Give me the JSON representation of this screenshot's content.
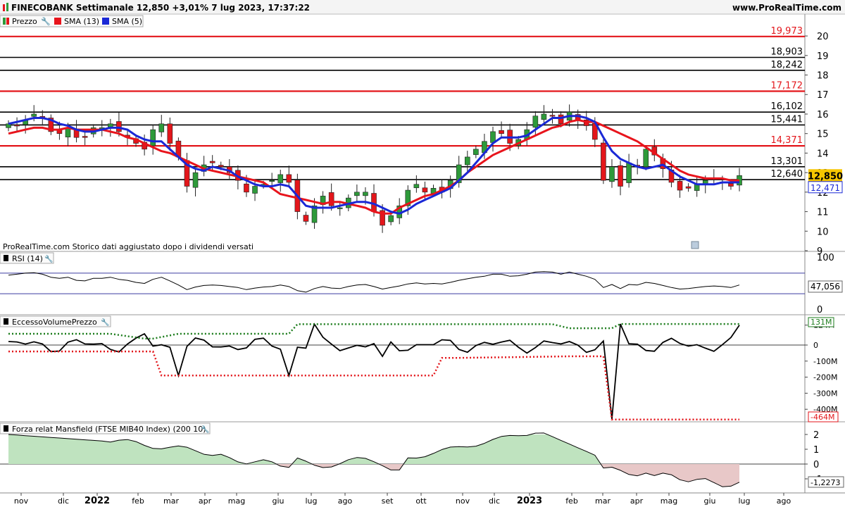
{
  "header": {
    "title": "FINECOBANK Settimanale 12,850 +3,01% 7 lug 2023, 17:37:22",
    "site": "www.ProRealTime.com"
  },
  "legend": {
    "price": "Prezzo",
    "sma13": "SMA (13)",
    "sma5": "SMA (5)"
  },
  "footnote": "ProRealTime.com  Storico dati aggiustato dopo i dividendi versati",
  "panels": {
    "rsi_title": "RSI (14)",
    "evp_title": "EccessoVolumePrezzo",
    "mansfield_title": "Forza relat Mansfield (FTSE MIB40 Index) (200 10)"
  },
  "colors": {
    "up": "#2e9a3a",
    "down": "#e3161b",
    "sma13": "#e8141c",
    "sma5": "#1a28d6",
    "level_red": "#e3161b",
    "level_black": "#000000",
    "rsi_band": "#3c3ca0",
    "dotted_green": "#1d7d1d",
    "dotted_red": "#e3161b",
    "mansfield_pos": "#bfe3bf",
    "mansfield_neg": "#e8c8c8",
    "last_price_bg": "#f7c600"
  },
  "chart_data": [
    {
      "type": "candlestick",
      "title": "FINECOBANK Settimanale",
      "last_price": "12,850",
      "change": "+3,01%",
      "sma13_label": "SMA (13)",
      "sma5_label": "SMA (5)",
      "sma5_last": "12,471",
      "ylim": [
        9,
        20.5
      ],
      "yticks": [
        "9",
        "10",
        "11",
        "12",
        "13",
        "14",
        "15",
        "16",
        "17",
        "18",
        "19",
        "20"
      ],
      "xticks": [
        "nov",
        "dic",
        "2022",
        "feb",
        "mar",
        "apr",
        "mag",
        "giu",
        "lug",
        "ago",
        "set",
        "ott",
        "nov",
        "dic",
        "2023",
        "feb",
        "mar",
        "apr",
        "mag",
        "giu",
        "lug",
        "ago"
      ],
      "levels": [
        {
          "value": 19.973,
          "label": "19,973",
          "color": "red"
        },
        {
          "value": 18.903,
          "label": "18,903",
          "color": "black"
        },
        {
          "value": 18.242,
          "label": "18,242",
          "color": "black"
        },
        {
          "value": 17.172,
          "label": "17,172",
          "color": "red"
        },
        {
          "value": 16.102,
          "label": "16,102",
          "color": "black"
        },
        {
          "value": 15.441,
          "label": "15,441",
          "color": "black"
        },
        {
          "value": 14.371,
          "label": "14,371",
          "color": "red"
        },
        {
          "value": 13.301,
          "label": "13,301",
          "color": "black"
        },
        {
          "value": 12.64,
          "label": "12,640",
          "color": "black"
        }
      ],
      "closes": [
        15.5,
        15.4,
        15.7,
        16.0,
        15.8,
        15.1,
        15.0,
        15.3,
        14.8,
        14.8,
        15.3,
        15.3,
        15.5,
        15.1,
        14.8,
        14.5,
        14.2,
        15.2,
        15.5,
        14.5,
        13.8,
        12.3,
        13.0,
        13.4,
        13.5,
        13.3,
        13.0,
        12.6,
        12.0,
        12.3,
        12.4,
        12.6,
        12.9,
        12.5,
        11.0,
        10.5,
        11.3,
        11.8,
        11.3,
        11.2,
        11.7,
        12.0,
        12.0,
        11.0,
        10.3,
        10.8,
        11.3,
        12.1,
        12.4,
        12.0,
        12.2,
        12.0,
        12.6,
        13.4,
        13.8,
        14.2,
        14.6,
        15.1,
        15.0,
        14.5,
        14.7,
        15.2,
        15.9,
        16.0,
        15.9,
        15.5,
        16.1,
        15.7,
        15.4,
        14.7,
        12.6,
        13.3,
        12.3,
        13.5,
        13.3,
        14.2,
        13.9,
        13.2,
        12.5,
        12.1,
        12.2,
        12.4,
        12.6,
        12.7,
        12.5,
        12.3,
        12.85
      ],
      "sma13": [
        15.0,
        15.1,
        15.2,
        15.3,
        15.3,
        15.2,
        15.2,
        15.3,
        15.2,
        15.2,
        15.2,
        15.2,
        15.1,
        15.0,
        14.8,
        14.7,
        14.5,
        14.3,
        14.1,
        14.0,
        13.8,
        13.6,
        13.4,
        13.2,
        13.1,
        13.0,
        12.9,
        12.8,
        12.7,
        12.6,
        12.5,
        12.2,
        11.9,
        11.8,
        11.7,
        11.6,
        11.5,
        11.4,
        11.5,
        11.5,
        11.4,
        11.3,
        11.2,
        11.0,
        10.9,
        10.9,
        11.2,
        11.4,
        11.6,
        11.8,
        11.9,
        12.1,
        12.3,
        12.6,
        13.0,
        13.3,
        13.6,
        13.9,
        14.1,
        14.3,
        14.5,
        14.7,
        14.9,
        15.1,
        15.3,
        15.4,
        15.6,
        15.7,
        15.6,
        15.6,
        15.4,
        15.2,
        15.0,
        14.8,
        14.6,
        14.3,
        14.0,
        13.7,
        13.4,
        13.1,
        12.9,
        12.8,
        12.7,
        12.7,
        12.7,
        12.6,
        12.6
      ],
      "sma5": [
        15.5,
        15.6,
        15.7,
        15.8,
        15.8,
        15.7,
        15.5,
        15.4,
        15.2,
        15.1,
        15.1,
        15.2,
        15.3,
        15.3,
        15.2,
        14.9,
        14.7,
        14.6,
        14.6,
        14.2,
        13.8,
        13.4,
        13.2,
        13.1,
        13.3,
        13.2,
        13.1,
        12.8,
        12.6,
        12.4,
        12.3,
        12.3,
        12.4,
        12.3,
        11.8,
        11.3,
        11.2,
        11.2,
        11.2,
        11.3,
        11.4,
        11.5,
        11.5,
        11.4,
        11.2,
        11.0,
        10.9,
        11.1,
        11.4,
        11.6,
        11.8,
        12.0,
        12.2,
        12.6,
        13.0,
        13.5,
        14.0,
        14.5,
        14.8,
        14.8,
        14.8,
        14.9,
        15.2,
        15.5,
        15.8,
        15.8,
        15.9,
        15.9,
        15.8,
        15.6,
        14.8,
        14.1,
        13.7,
        13.5,
        13.3,
        13.2,
        13.3,
        13.4,
        13.1,
        12.8,
        12.6,
        12.4,
        12.4,
        12.4,
        12.5,
        12.5,
        12.5
      ]
    },
    {
      "type": "line",
      "title": "RSI (14)",
      "ylim": [
        0,
        100
      ],
      "yticks": [
        "0",
        "100"
      ],
      "bands": [
        30,
        70
      ],
      "last_value": "47,056",
      "values": [
        66,
        68,
        70,
        71,
        68,
        62,
        60,
        62,
        56,
        55,
        60,
        60,
        62,
        58,
        56,
        52,
        50,
        58,
        62,
        55,
        47,
        38,
        43,
        46,
        47,
        46,
        44,
        42,
        38,
        41,
        43,
        44,
        47,
        44,
        36,
        33,
        40,
        44,
        41,
        40,
        44,
        47,
        48,
        44,
        39,
        42,
        45,
        49,
        51,
        49,
        50,
        49,
        52,
        56,
        59,
        62,
        64,
        68,
        68,
        64,
        65,
        68,
        72,
        73,
        72,
        68,
        72,
        68,
        64,
        58,
        42,
        48,
        40,
        48,
        47,
        52,
        50,
        46,
        42,
        39,
        40,
        42,
        44,
        45,
        44,
        42,
        47
      ]
    },
    {
      "type": "line",
      "title": "EccessoVolumePrezzo",
      "ylim": [
        -500,
        200
      ],
      "yticks": [
        "-400M",
        "-300M",
        "-200M",
        "-100M",
        "0",
        "124M"
      ],
      "upper_label": "131M",
      "lower_label": "-464M",
      "unit": "M"
    },
    {
      "type": "area",
      "title": "Forza relat Mansfield (FTSE MIB40 Index) (200 10)",
      "ylim": [
        -1.6,
        2.5
      ],
      "yticks": [
        "-1",
        "0",
        "1",
        "2"
      ],
      "last_value": "-1,2273"
    }
  ]
}
